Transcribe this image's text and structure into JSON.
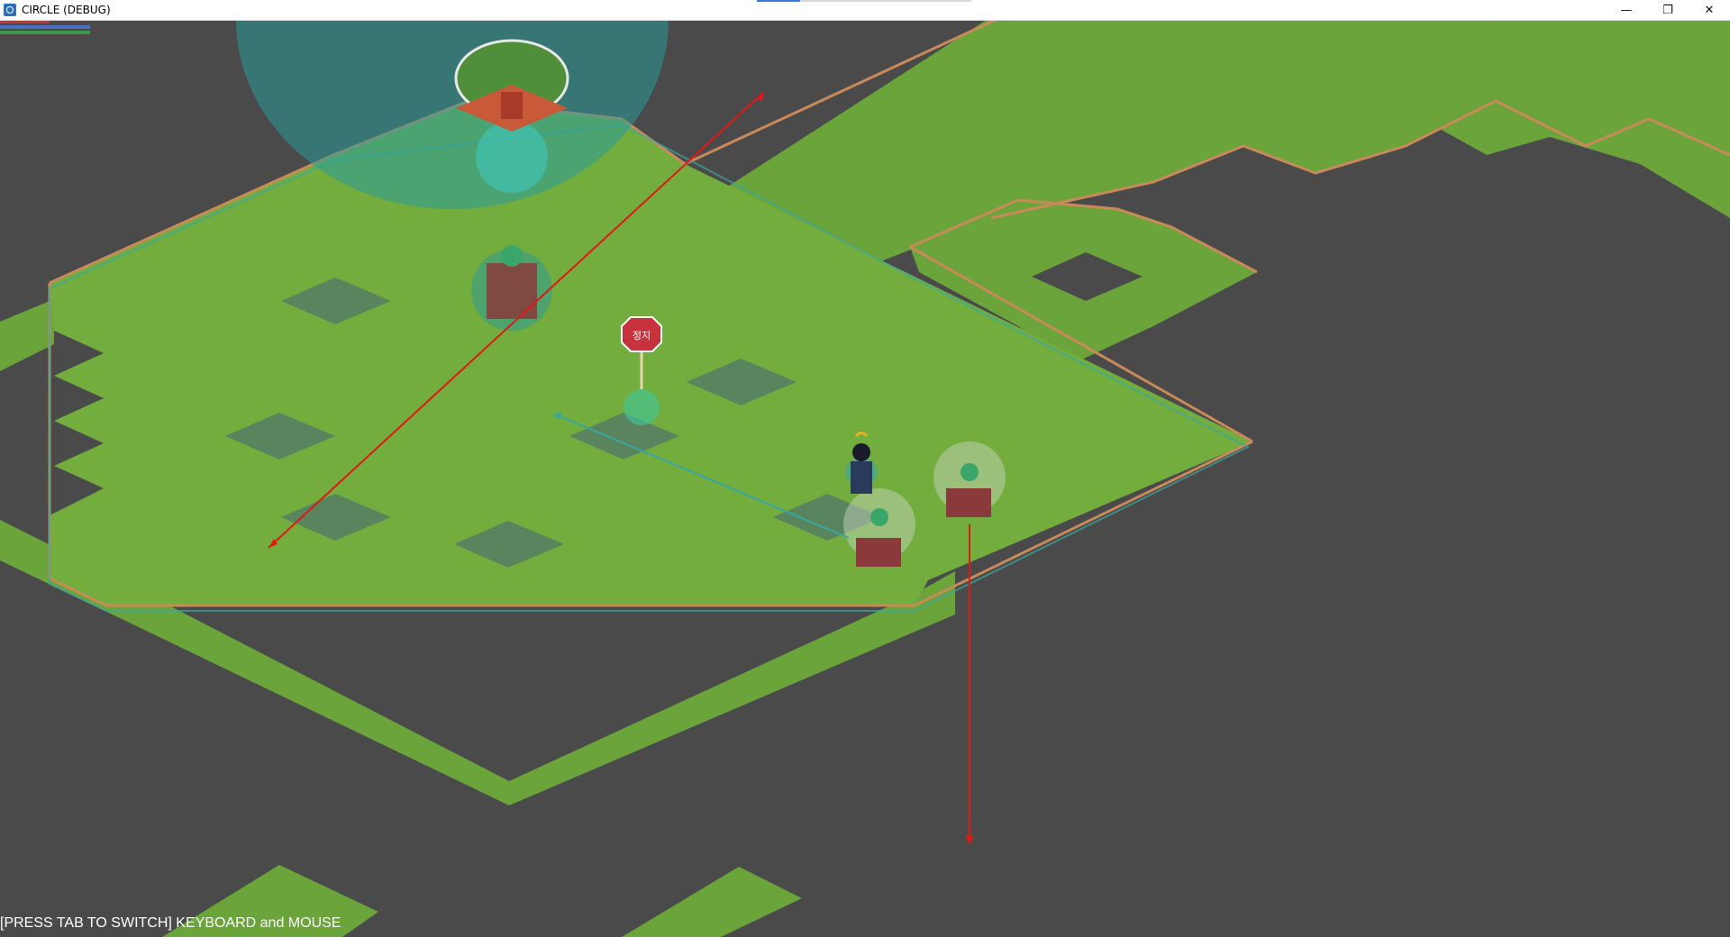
{
  "window": {
    "title": "CIRCLE (DEBUG)",
    "minimize_glyph": "—",
    "restore_glyph": "❐",
    "close_glyph": "✕"
  },
  "hud": {
    "bars": [
      {
        "name": "health",
        "color": "#c8323c",
        "fill": 0.55
      },
      {
        "name": "mana",
        "color": "#4a6fbf",
        "fill": 1.0
      },
      {
        "name": "stamina",
        "color": "#3a9a4a",
        "fill": 1.0
      }
    ]
  },
  "sign": {
    "text": "정지"
  },
  "hint": {
    "text": "[PRESS TAB TO SWITCH] KEYBOARD and MOUSE"
  },
  "colors": {
    "void": "#4a4a4a",
    "grass": "#6aa43a",
    "grass_light": "#8cc04a",
    "debug_line": "#e01818",
    "debug_teal": "#3aa6a0"
  }
}
